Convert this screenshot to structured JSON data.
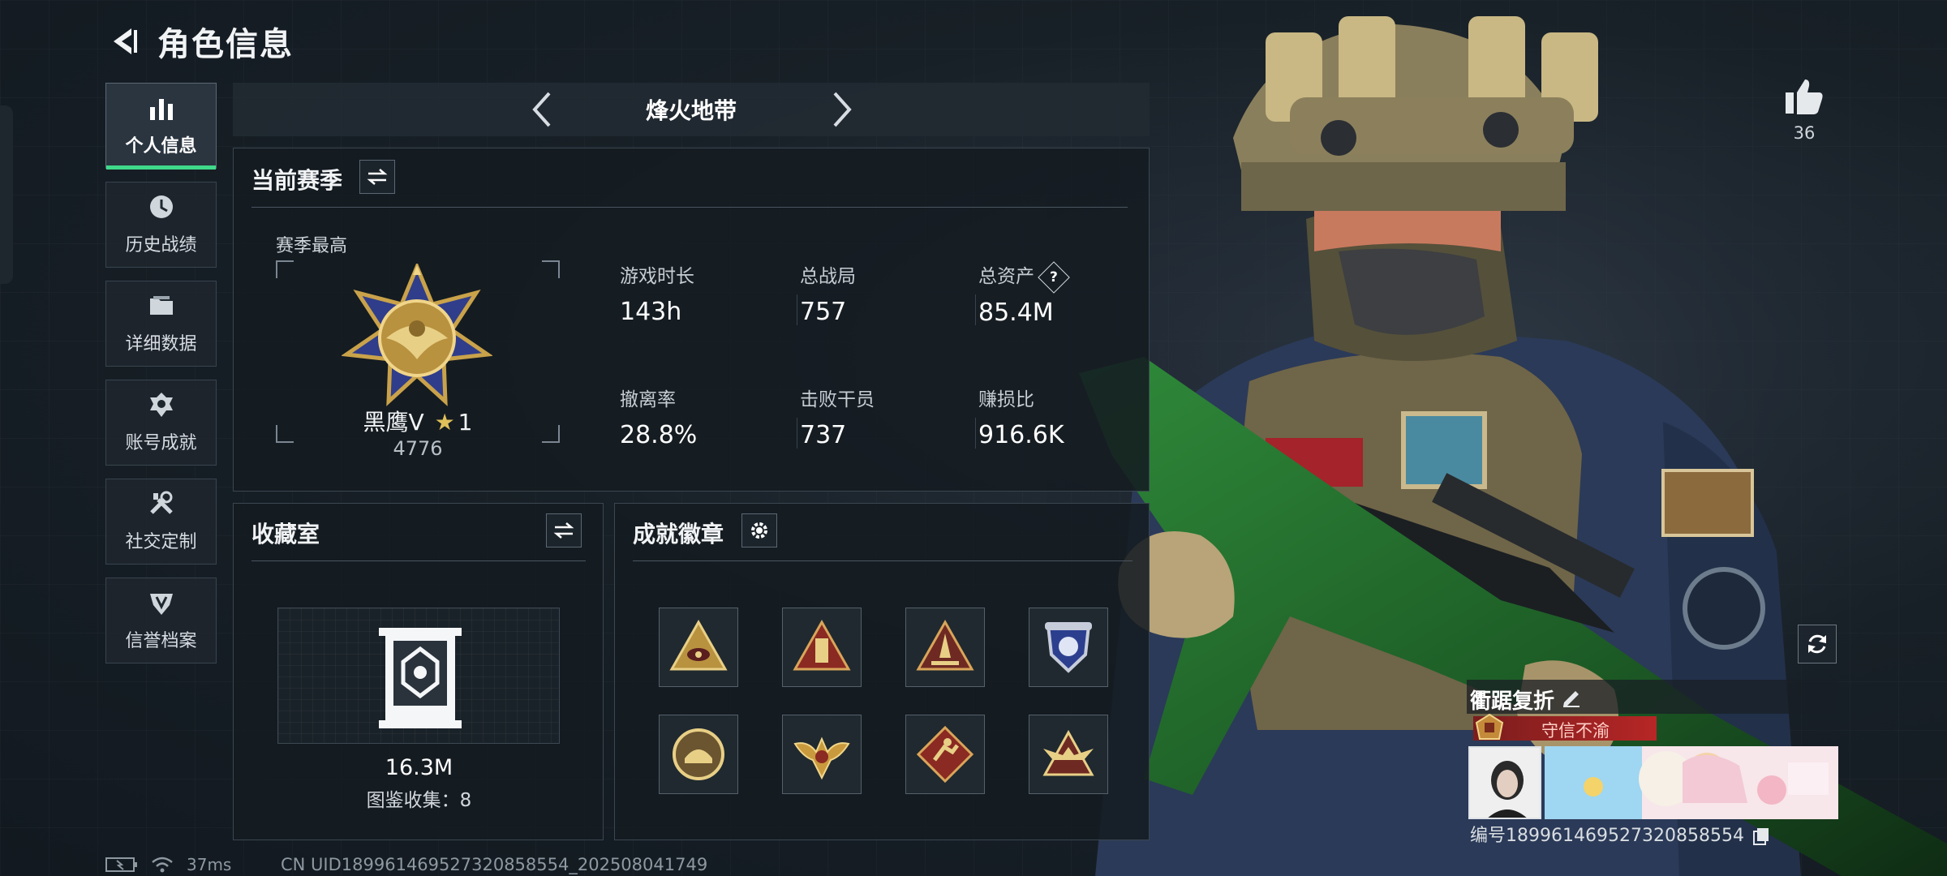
{
  "header": {
    "title": "角色信息"
  },
  "sidebar": {
    "items": [
      {
        "label": "个人信息",
        "icon": "bar-chart-icon",
        "active": true
      },
      {
        "label": "历史战绩",
        "icon": "clock-icon",
        "active": false
      },
      {
        "label": "详细数据",
        "icon": "folder-icon",
        "active": false
      },
      {
        "label": "账号成就",
        "icon": "medal-icon",
        "active": false
      },
      {
        "label": "社交定制",
        "icon": "tools-icon",
        "active": false
      },
      {
        "label": "信誉档案",
        "icon": "shield-badge-icon",
        "active": false
      }
    ]
  },
  "mode": {
    "title": "烽火地带"
  },
  "season": {
    "title": "当前赛季",
    "best_label": "赛季最高",
    "rank_name": "黑鹰V",
    "rank_stars": "1",
    "rank_points": "4776",
    "stats": [
      {
        "label": "游戏时长",
        "value": "143h"
      },
      {
        "label": "总战局",
        "value": "757"
      },
      {
        "label": "总资产",
        "value": "85.4M",
        "help": "?"
      },
      {
        "label": "撤离率",
        "value": "28.8%"
      },
      {
        "label": "击败干员",
        "value": "737"
      },
      {
        "label": "赚损比",
        "value": "916.6K"
      }
    ]
  },
  "collection": {
    "title": "收藏室",
    "value": "16.3M",
    "count_text": "图鉴收集：8"
  },
  "achievements": {
    "title": "成就徽章",
    "badges": [
      "triangle-eye-badge",
      "triangle-tower-badge",
      "triangle-rocket-badge",
      "blue-shield-badge",
      "round-helmet-badge",
      "winged-crest-badge",
      "diamond-runner-badge",
      "triangle-wings-badge"
    ]
  },
  "profile": {
    "likes": "36",
    "player_name": "衢踞复折",
    "title_text": "守信不渝",
    "player_id": "编号18996146952732085855​4"
  },
  "status": {
    "ping": "37ms",
    "uid": "CN UID18996146952732085855​4_202508041749"
  },
  "colors": {
    "accent": "#3fd98a",
    "title_red": "#b72626",
    "panel_border": "#3b4650"
  }
}
